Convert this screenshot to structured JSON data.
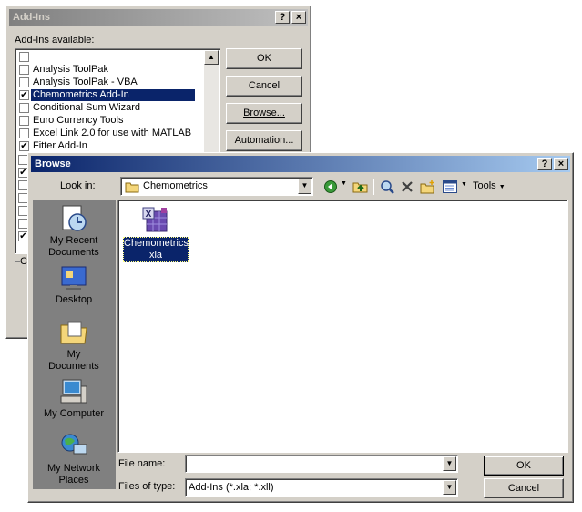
{
  "addins": {
    "title": "Add-Ins",
    "help_btn": "?",
    "close_btn": "×",
    "list_label": "Add-Ins available:",
    "items": [
      {
        "label": "",
        "checked": false
      },
      {
        "label": "Analysis ToolPak",
        "checked": false
      },
      {
        "label": "Analysis ToolPak - VBA",
        "checked": false
      },
      {
        "label": "Chemometrics Add-In",
        "checked": true,
        "selected": true
      },
      {
        "label": "Conditional Sum Wizard",
        "checked": false
      },
      {
        "label": "Euro Currency Tools",
        "checked": false
      },
      {
        "label": "Excel Link 2.0 for use with MATLAB",
        "checked": false
      },
      {
        "label": "Fitter Add-In",
        "checked": true
      }
    ],
    "hidden_checks": [
      false,
      true,
      false,
      false,
      false,
      false,
      true
    ],
    "group_label_fragment": "C",
    "ok": "OK",
    "cancel": "Cancel",
    "browse": "Browse...",
    "automation": "Automation..."
  },
  "browse": {
    "title": "Browse",
    "help_btn": "?",
    "close_btn": "×",
    "look_in_label": "Look in:",
    "look_in_value": "Chemometrics",
    "tools_label": "Tools",
    "places": [
      {
        "label": "My Recent Documents",
        "icon": "recent-documents-icon"
      },
      {
        "label": "Desktop",
        "icon": "desktop-icon"
      },
      {
        "label": "My Documents",
        "icon": "my-documents-icon"
      },
      {
        "label": "My Computer",
        "icon": "my-computer-icon"
      },
      {
        "label": "My Network Places",
        "icon": "network-places-icon"
      }
    ],
    "file": {
      "name": "Chemometrics.xla",
      "line1": "Chemometrics.",
      "line2": "xla",
      "icon": "excel-addin-file-icon"
    },
    "file_name_label": "File name:",
    "file_name_value": "",
    "files_of_type_label": "Files of type:",
    "files_of_type_value": "Add-Ins (*.xla; *.xll)",
    "ok": "OK",
    "cancel": "Cancel"
  },
  "colors": {
    "selection": "#0a246a",
    "face": "#d4d0c8",
    "active_title": "#0a246a"
  }
}
